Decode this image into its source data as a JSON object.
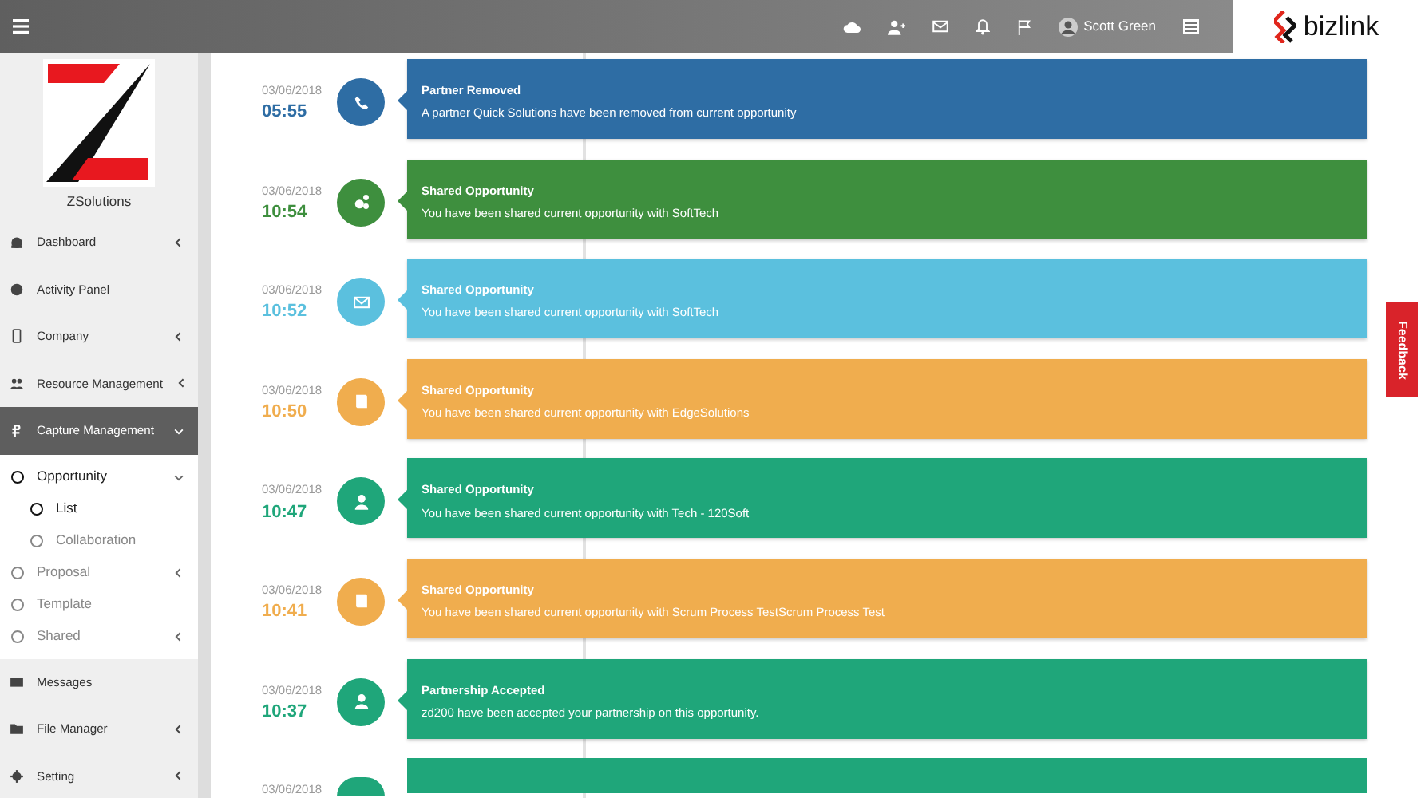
{
  "topbar": {
    "user_name": "Scott Green",
    "brand": "bizlink"
  },
  "sidebar": {
    "company_name": "ZSolutions",
    "items": [
      {
        "label": "Dashboard",
        "kind": "dashboard",
        "expanded": false,
        "selected": false
      },
      {
        "label": "Activity Panel",
        "kind": "activity",
        "selected": false
      },
      {
        "label": "Company",
        "kind": "mobile",
        "expanded": false,
        "selected": false
      },
      {
        "label": "Resource Management",
        "kind": "users",
        "expanded": false,
        "selected": false
      },
      {
        "label": "Capture Management",
        "kind": "ruble",
        "expanded": true,
        "selected": true,
        "children": [
          {
            "label": "Opportunity",
            "expanded": true,
            "selected": true,
            "children": [
              {
                "label": "List",
                "selected": true
              },
              {
                "label": "Collaboration",
                "selected": false
              }
            ]
          },
          {
            "label": "Proposal",
            "expanded": false,
            "selected": false
          },
          {
            "label": "Template",
            "selected": false
          },
          {
            "label": "Shared",
            "expanded": false,
            "selected": false
          }
        ]
      },
      {
        "label": "Messages",
        "kind": "envelope",
        "selected": false
      },
      {
        "label": "File Manager",
        "kind": "folder",
        "expanded": false,
        "selected": false
      },
      {
        "label": "Setting",
        "kind": "gear",
        "expanded": false,
        "selected": false
      }
    ]
  },
  "timeline": [
    {
      "date": "03/06/2018",
      "time": "05:55",
      "kind": "phone",
      "color": "#2e6da4",
      "title": "Partner Removed",
      "text": "A partner Quick Solutions have been removed from current opportunity"
    },
    {
      "date": "03/06/2018",
      "time": "10:54",
      "kind": "gears",
      "color": "#3e8f3e",
      "title": "Shared Opportunity",
      "text": "You have been shared current opportunity with SoftTech"
    },
    {
      "date": "03/06/2018",
      "time": "10:52",
      "kind": "envelope",
      "color": "#5bc0de",
      "title": "Shared Opportunity",
      "text": "You have been shared current opportunity with SoftTech"
    },
    {
      "date": "03/06/2018",
      "time": "10:50",
      "kind": "book",
      "color": "#f0ad4e",
      "title": "Shared Opportunity",
      "text": "You have been shared current opportunity with EdgeSolutions"
    },
    {
      "date": "03/06/2018",
      "time": "10:47",
      "kind": "user",
      "color": "#1fa67a",
      "title": "Shared Opportunity",
      "text": "You have been shared current opportunity with Tech - 120Soft"
    },
    {
      "date": "03/06/2018",
      "time": "10:41",
      "kind": "book",
      "color": "#f0ad4e",
      "title": "Shared Opportunity",
      "text": "You have been shared current opportunity with Scrum Process TestScrum Process Test"
    },
    {
      "date": "03/06/2018",
      "time": "10:37",
      "kind": "user",
      "color": "#1fa67a",
      "title": "Partnership Accepted",
      "text": "zd200 have been accepted your partnership on this opportunity."
    },
    {
      "date": "03/06/2018",
      "color": "#1fa67a"
    }
  ],
  "feedback_tab": {
    "label": "Feedback"
  }
}
